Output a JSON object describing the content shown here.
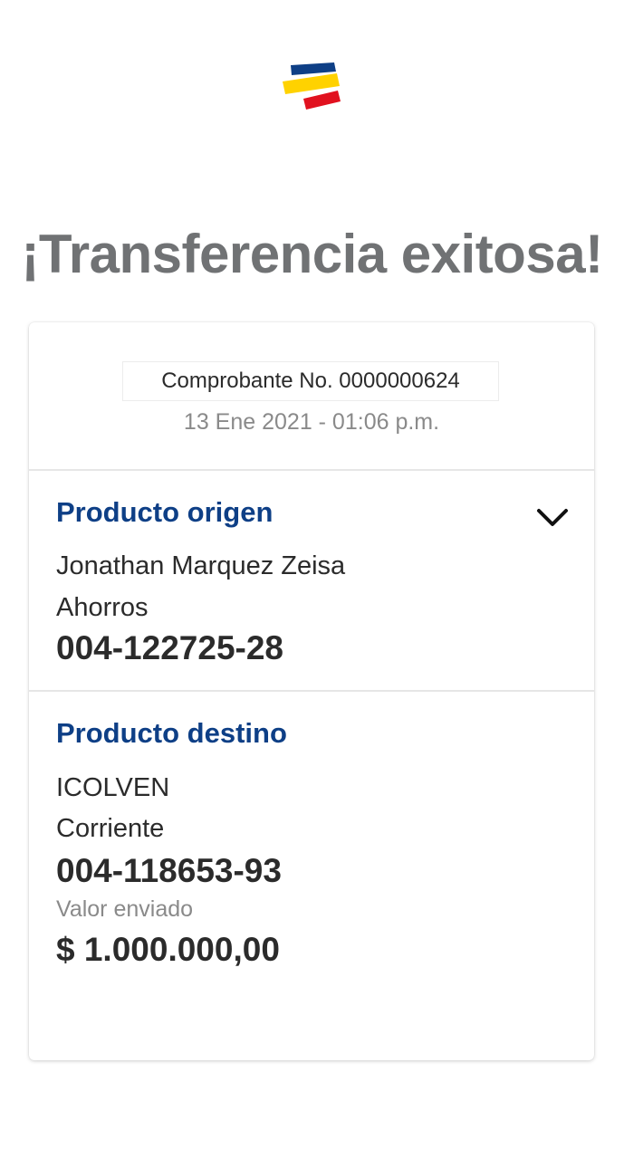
{
  "brand": {
    "logo_icon": "bank-flag-logo-icon",
    "colors": {
      "blue": "#0e3f86",
      "yellow": "#ffd200",
      "red": "#e1111f"
    }
  },
  "title": "¡Transferencia exitosa!",
  "receipt": {
    "label": "Comprobante No. 0000000624",
    "date": "13 Ene 2021 - 01:06 p.m."
  },
  "origin": {
    "title": "Producto origen",
    "toggle_icon": "chevron-down-icon",
    "holder": "Jonathan Marquez Zeisa",
    "account_type": "Ahorros",
    "account_number": "004-122725-28"
  },
  "destination": {
    "title": "Producto destino",
    "holder": "ICOLVEN",
    "account_type": "Corriente",
    "account_number": "004-118653-93",
    "value_label": "Valor enviado",
    "value_amount": "$ 1.000.000,00"
  }
}
